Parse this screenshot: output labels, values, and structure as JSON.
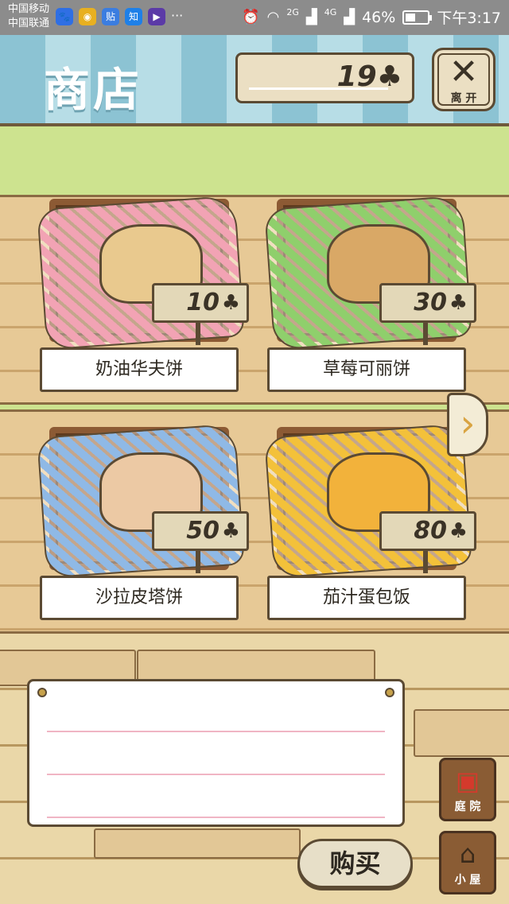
{
  "status_bar": {
    "carrier1": "中国移动",
    "carrier2": "中国联通",
    "apps": [
      {
        "icon": "baidu-icon",
        "glyph": "🐾",
        "color": "#2f6fe4"
      },
      {
        "icon": "weibo-icon",
        "glyph": "◉",
        "color": "#e8b020"
      },
      {
        "icon": "tieba-icon",
        "glyph": "贴",
        "color": "#3b7de0"
      },
      {
        "icon": "zhihu-icon",
        "glyph": "知",
        "color": "#1e80e8"
      },
      {
        "icon": "video-icon",
        "glyph": "▶",
        "color": "#5b3aa7"
      }
    ],
    "more": "···",
    "net1": "2G",
    "net2": "4G",
    "battery_text": "46%",
    "battery_level": 0.46,
    "time": "下午3:17"
  },
  "header": {
    "title": "商店",
    "coins": "19",
    "coin_icon": "♣",
    "close_glyph": "✕",
    "leave_label": "离 开"
  },
  "items": [
    {
      "name": "奶油华夫饼",
      "price": "10",
      "cloth_color": "#f2a3b4",
      "food_color": "#e9c98e"
    },
    {
      "name": "草莓可丽饼",
      "price": "30",
      "cloth_color": "#8fcf6c",
      "food_color": "#d9a866"
    },
    {
      "name": "沙拉皮塔饼",
      "price": "50",
      "cloth_color": "#8fb9e6",
      "food_color": "#ecc9a4"
    },
    {
      "name": "茄汁蛋包饭",
      "price": "80",
      "cloth_color": "#f3c13a",
      "food_color": "#f2b23b"
    }
  ],
  "next_arrow": "›",
  "buy_label": "购买",
  "nav": {
    "yard_label": "庭 院",
    "house_label": "小 屋",
    "yard_icon": "mailbox-icon",
    "house_icon": "house-icon"
  }
}
